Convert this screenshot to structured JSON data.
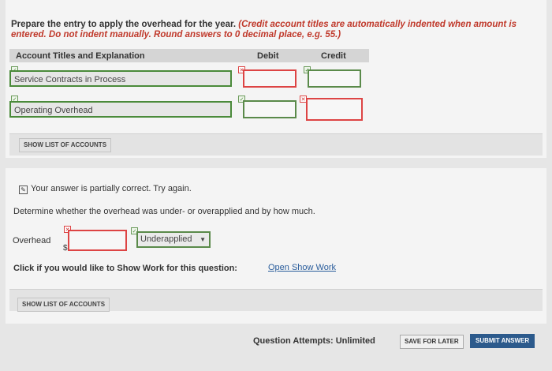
{
  "instructions": {
    "lead": "Prepare the entry to apply the overhead for the year.",
    "note": "(Credit account titles are automatically indented when amount is entered. Do not indent manually. Round answers to 0 decimal place, e.g. 55.)"
  },
  "table": {
    "header_account": "Account Titles and Explanation",
    "header_debit": "Debit",
    "header_credit": "Credit",
    "rows": [
      {
        "account": "Service Contracts in Process",
        "debit": "",
        "credit": ""
      },
      {
        "account": "Operating Overhead",
        "debit": "",
        "credit": ""
      }
    ]
  },
  "buttons": {
    "show_list_1": "SHOW LIST OF ACCOUNTS",
    "show_list_2": "SHOW LIST OF ACCOUNTS",
    "save_later": "SAVE FOR LATER",
    "submit": "SUBMIT ANSWER"
  },
  "feedback": {
    "partial": "Your answer is partially correct.  Try again."
  },
  "question2": {
    "text": "Determine whether the overhead was under- or overapplied and by how much.",
    "overhead_label": "Overhead",
    "currency": "$",
    "amount_value": "",
    "select_value": "Underapplied"
  },
  "show_work": {
    "text": "Click if you would like to Show Work for this question:",
    "link": "Open Show Work"
  },
  "attempts": "Question Attempts: Unlimited",
  "icons": {
    "correct": "check-icon",
    "incorrect": "x-icon",
    "dropdown": "triangle-down-icon"
  },
  "colors": {
    "correct": "#4a8a3a",
    "incorrect": "#d44444",
    "link": "#2a5d9c",
    "submit_bg": "#2c5a8c"
  }
}
